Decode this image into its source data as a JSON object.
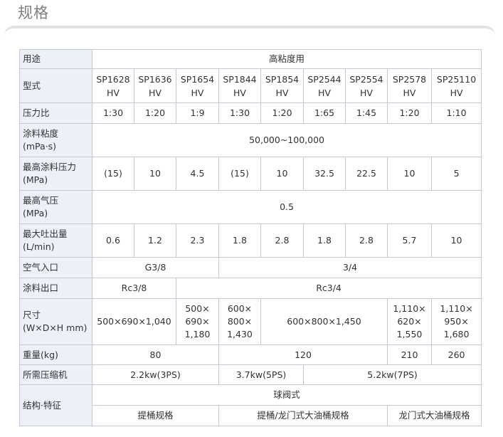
{
  "title": "规格",
  "rows": {
    "usage": {
      "label": "用途",
      "value": "高粘度用"
    },
    "model": {
      "label": "型式",
      "values": [
        [
          "SP1628",
          "HV"
        ],
        [
          "SP1636",
          "HV"
        ],
        [
          "SP1654",
          "HV"
        ],
        [
          "SP1844",
          "HV"
        ],
        [
          "SP1854",
          "HV"
        ],
        [
          "SP2544",
          "HV"
        ],
        [
          "SP2554",
          "HV"
        ],
        [
          "SP2578",
          "HV"
        ],
        [
          "SP25110",
          "HV"
        ]
      ]
    },
    "ratio": {
      "label": "压力比",
      "values": [
        "1:30",
        "1:20",
        "1:9",
        "1:30",
        "1:20",
        "1:65",
        "1:45",
        "1:20",
        "1:10"
      ]
    },
    "viscosity": {
      "label": [
        "涂料粘度",
        "(mPa·s)"
      ],
      "value": "50,000~100,000"
    },
    "max_paint_pressure": {
      "label": [
        "最高涂料压力",
        "(MPa)"
      ],
      "values": [
        "(15)",
        "10",
        "4.5",
        "(15)",
        "10",
        "32.5",
        "22.5",
        "10",
        "5"
      ]
    },
    "max_air_pressure": {
      "label": [
        "最高气压",
        "(MPa)"
      ],
      "value": "0.5"
    },
    "max_output": {
      "label": [
        "最大吐出量",
        "(L/min)"
      ],
      "values": [
        "0.6",
        "1.2",
        "2.3",
        "1.8",
        "2.8",
        "1.8",
        "2.8",
        "5.7",
        "10"
      ]
    },
    "air_inlet": {
      "label": "空气入口",
      "values": [
        "G3/8",
        "3/4"
      ]
    },
    "paint_outlet": {
      "label": "涂料出口",
      "values": [
        "Rc3/8",
        "Rc3/4"
      ]
    },
    "dimensions": {
      "label": [
        "尺寸",
        "(W×D×H mm)"
      ],
      "values": [
        [
          "500×690×1,040"
        ],
        [
          "500×",
          "690×",
          "1,180"
        ],
        [
          "600×",
          "800×",
          "1,430"
        ],
        [
          "600×800×1,450"
        ],
        [
          "1,110×",
          "620×",
          "1,550"
        ],
        [
          "1,110×",
          "950×",
          "1,680"
        ]
      ]
    },
    "weight": {
      "label": "重量(kg)",
      "values": [
        "80",
        "120",
        "210",
        "260"
      ]
    },
    "compressor": {
      "label": "所需压缩机",
      "values": [
        "2.2kw(3PS)",
        "3.7kw(5PS)",
        "5.2kw(7PS)"
      ]
    },
    "features": {
      "label": "结构·特征",
      "top": "球阀式",
      "bottom": [
        "提桶规格",
        "提桶/龙门式大油桶规格",
        "龙门式大油桶规格"
      ]
    }
  }
}
